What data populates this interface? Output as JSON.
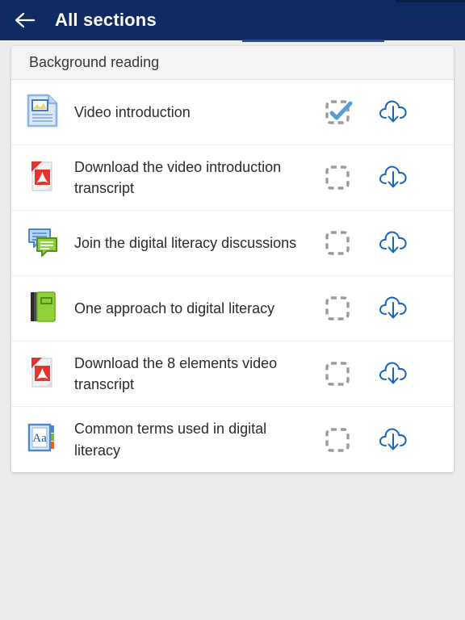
{
  "appbar": {
    "back_icon": "arrow-left-icon",
    "title": "All sections",
    "background_color": "#0f2b61",
    "title_color": "#ffffff"
  },
  "section": {
    "title": "Background reading",
    "header_background": "#f4f4f4"
  },
  "colors": {
    "page_background": "#ececec",
    "card_background": "#ffffff",
    "accent_blue": "#1565c0",
    "check_blue": "#5b9bd5",
    "dash_gray": "#9a9a9a",
    "text": "#2b2b2b"
  },
  "activities": [
    {
      "label": "Video introduction",
      "icon": "page-document-icon",
      "completion_icon": "checkbox-checked-dashed-icon",
      "completed": true,
      "download_icon": "cloud-download-icon"
    },
    {
      "label": "Download the video introduction transcript",
      "icon": "pdf-file-icon",
      "completion_icon": "checkbox-empty-dashed-icon",
      "completed": false,
      "download_icon": "cloud-download-icon"
    },
    {
      "label": "Join the digital literacy discussions",
      "icon": "forum-discussion-icon",
      "completion_icon": "checkbox-empty-dashed-icon",
      "completed": false,
      "download_icon": "cloud-download-icon"
    },
    {
      "label": "One approach to digital literacy",
      "icon": "book-icon",
      "completion_icon": "checkbox-empty-dashed-icon",
      "completed": false,
      "download_icon": "cloud-download-icon"
    },
    {
      "label": "Download the 8 elements video transcript",
      "icon": "pdf-file-icon",
      "completion_icon": "checkbox-empty-dashed-icon",
      "completed": false,
      "download_icon": "cloud-download-icon"
    },
    {
      "label": "Common terms used in digital literacy",
      "icon": "glossary-icon",
      "completion_icon": "checkbox-empty-dashed-icon",
      "completed": false,
      "download_icon": "cloud-download-icon"
    }
  ]
}
